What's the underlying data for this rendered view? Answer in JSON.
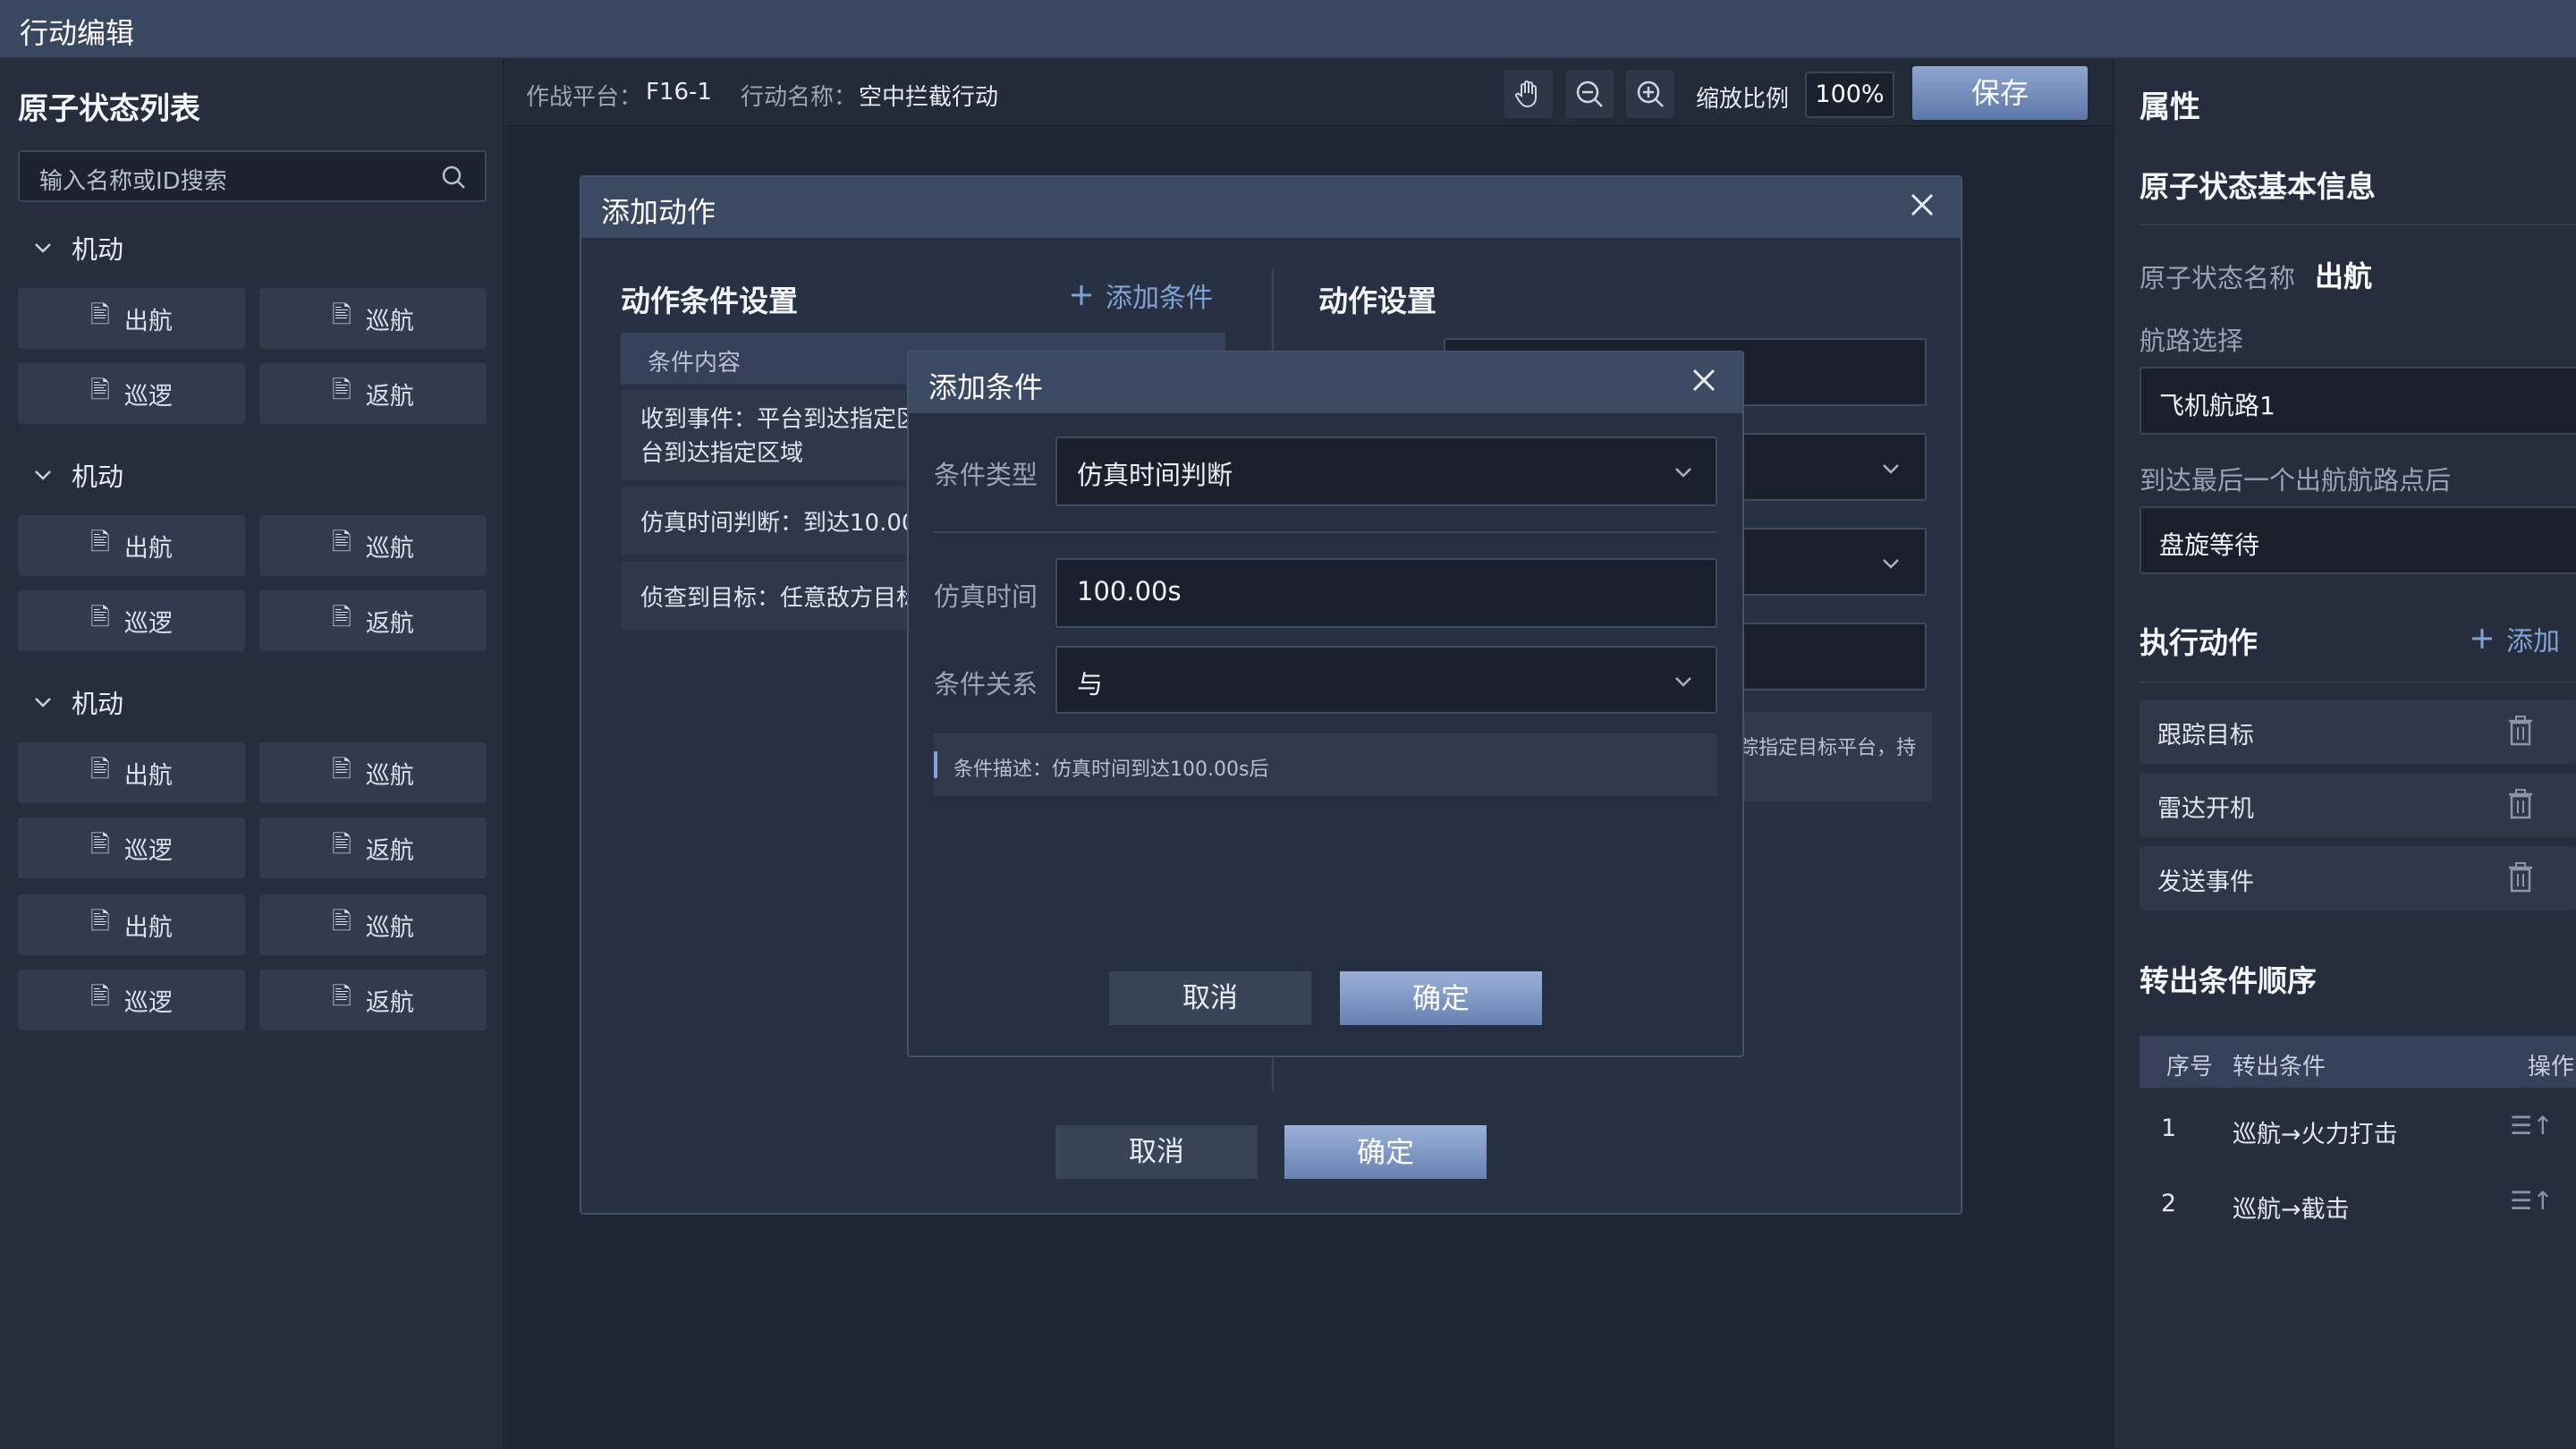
{
  "window": {
    "title": "行动编辑"
  },
  "left": {
    "title": "原子状态列表",
    "search_placeholder": "输入名称或ID搜索",
    "groups": [
      {
        "label": "机动",
        "items": [
          "出航",
          "巡航",
          "巡逻",
          "返航"
        ]
      },
      {
        "label": "机动",
        "items": [
          "出航",
          "巡航",
          "巡逻",
          "返航"
        ]
      },
      {
        "label": "机动",
        "items": [
          "出航",
          "巡航",
          "巡逻",
          "返航",
          "出航",
          "巡航",
          "巡逻",
          "返航"
        ]
      }
    ]
  },
  "toolbar": {
    "platform_label": "作战平台：",
    "platform_value": "F16-1",
    "action_label": "行动名称：",
    "action_value": "空中拦截行动",
    "zoom_label": "缩放比例",
    "zoom_value": "100%",
    "save_label": "保存"
  },
  "add_action_dialog": {
    "title": "添加动作",
    "conditions_title": "动作条件设置",
    "add_condition": "添加条件",
    "table_header": "条件内容",
    "conditions": [
      "收到事件：平台到达指定区",
      "台到达指定区域",
      "仿真时间判断：到达10.00",
      "侦查到目标：任意敌方目标"
    ],
    "settings_title": "动作设置",
    "settings_desc": "踪指定目标平台，持",
    "cancel": "取消",
    "ok": "确定"
  },
  "add_condition_dialog": {
    "title": "添加条件",
    "type_label": "条件类型",
    "type_value": "仿真时间判断",
    "time_label": "仿真时间",
    "time_value": "100.00s",
    "relation_label": "条件关系",
    "relation_value": "与",
    "description": "条件描述：仿真时间到达100.00s后",
    "cancel": "取消",
    "ok": "确定"
  },
  "right": {
    "title": "属性",
    "basic_info": "原子状态基本信息",
    "name_label": "原子状态名称",
    "name_value": "出航",
    "route_label": "航路选择",
    "route_value": "飞机航路1",
    "after_label": "到达最后一个出航航路点后",
    "after_value": "盘旋等待",
    "exec_title": "执行动作",
    "exec_add": "添加",
    "actions": [
      "跟踪目标",
      "雷达开机",
      "发送事件"
    ],
    "transfer_title": "转出条件顺序",
    "table_headers": [
      "序号",
      "转出条件",
      "操作"
    ],
    "rows": [
      {
        "no": "1",
        "cond": "巡航→火力打击"
      },
      {
        "no": "2",
        "cond": "巡航→截击"
      }
    ]
  },
  "colors": {
    "accent": "#7fa2d8",
    "header": "#3b4963",
    "primary_button": "#6781b2"
  }
}
